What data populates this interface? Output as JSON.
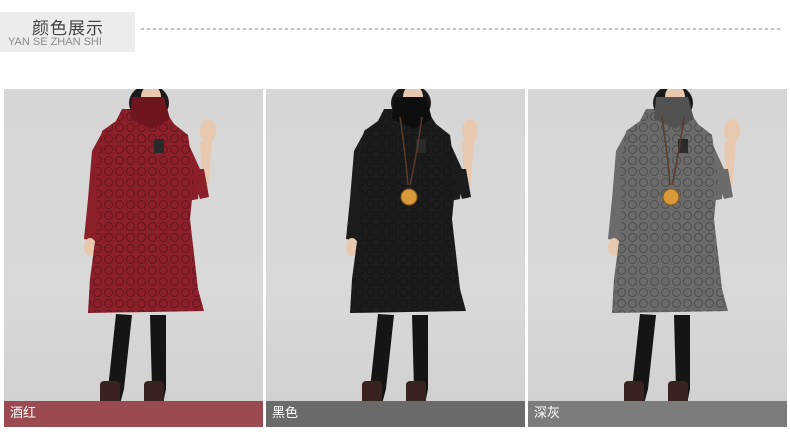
{
  "header": {
    "title": "颜色展示",
    "subtitle": "YAN SE ZHAN SHI"
  },
  "products": [
    {
      "label": "酒红",
      "color": "#8b1f2a",
      "dark": "#6e1520",
      "caption_bg": "#9a4a50"
    },
    {
      "label": "黑色",
      "color": "#1c1c1c",
      "dark": "#0e0e0e",
      "caption_bg": "#6a6a6a"
    },
    {
      "label": "深灰",
      "color": "#6b6b6b",
      "dark": "#525252",
      "caption_bg": "#7c7c7c"
    }
  ]
}
